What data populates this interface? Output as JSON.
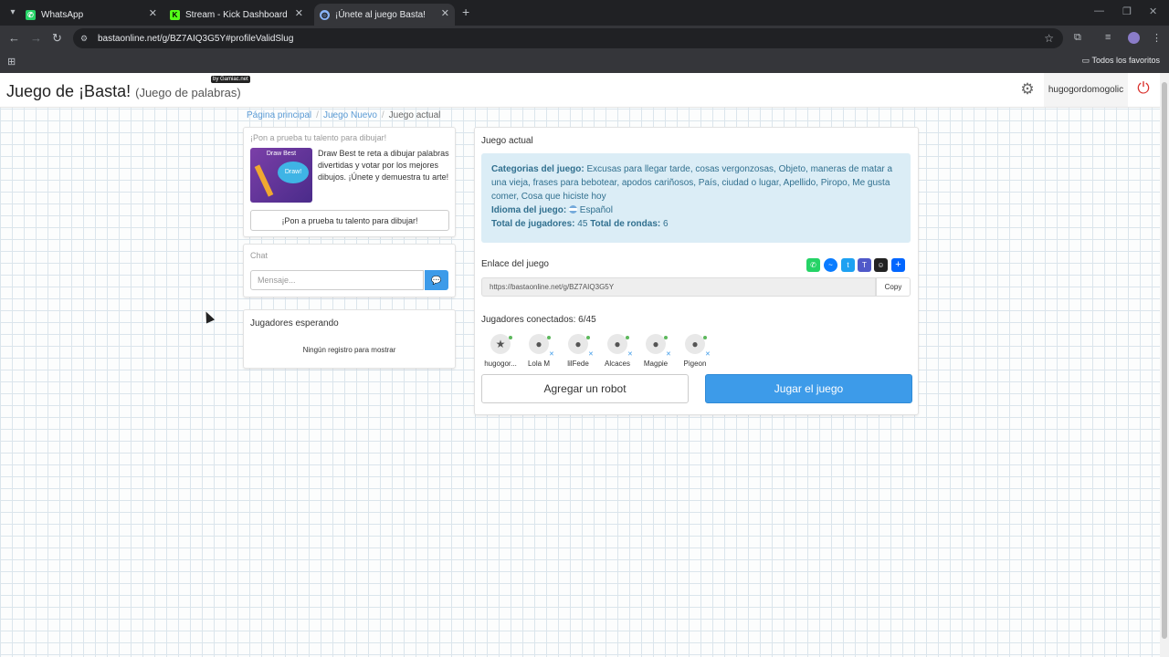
{
  "browser": {
    "tabs": [
      {
        "title": "WhatsApp",
        "icon": "whatsapp-icon"
      },
      {
        "title": "Stream - Kick Dashboard",
        "icon": "kick-icon"
      },
      {
        "title": "¡Únete al juego Basta!",
        "icon": "globe-icon"
      }
    ],
    "url": "bastaonline.net/g/BZ7AIQ3G5Y#profileValidSlug",
    "bookmarks_folder": "Todos los favoritos"
  },
  "header": {
    "title": "Juego de ¡Basta!",
    "subtitle": "(Juego de palabras)",
    "badge": "by Gamiac.net",
    "username": "hugogordomogolic"
  },
  "breadcrumb": {
    "home": "Página principal",
    "new_game": "Juego Nuevo",
    "current": "Juego actual"
  },
  "promo": {
    "title": "¡Pon a prueba tu talento para dibujar!",
    "image_title": "Draw Best",
    "image_bubble": "Draw!",
    "description": "Draw Best te reta a dibujar palabras divertidas y votar por los mejores dibujos. ¡Únete y demuestra tu arte!",
    "button_label": "¡Pon a prueba tu talento para dibujar!"
  },
  "chat": {
    "title": "Chat",
    "placeholder": "Mensaje..."
  },
  "waiting": {
    "title": "Jugadores esperando",
    "empty": "Ningún registro para mostrar"
  },
  "game": {
    "title": "Juego actual",
    "categories_label": "Categorias del juego:",
    "categories": "Excusas para llegar tarde, cosas vergonzosas, Objeto, maneras de matar a una vieja, frases para bebotear, apodos cariñosos, País, ciudad o lugar, Apellido, Piropo, Me gusta comer, Cosa que hiciste hoy",
    "language_label": "Idioma del juego:",
    "language": "Español",
    "players_total_label": "Total de jugadores:",
    "players_total": "45",
    "rounds_label": "Total de rondas:",
    "rounds": "6",
    "link_label": "Enlace del juego",
    "link": "https://bastaonline.net/g/BZ7AIQ3G5Y",
    "copy_label": "Copy",
    "connected_label": "Jugadores conectados: 6/45",
    "players": [
      {
        "name": "hugogor...",
        "icon": "host-user-icon"
      },
      {
        "name": "Lola M",
        "icon": "user-icon"
      },
      {
        "name": "lilFede",
        "icon": "user-icon"
      },
      {
        "name": "Alcaces",
        "icon": "user-icon"
      },
      {
        "name": "Magpie",
        "icon": "user-icon"
      },
      {
        "name": "Pigeon",
        "icon": "user-icon"
      }
    ],
    "add_robot_label": "Agregar un robot",
    "play_label": "Jugar el juego"
  },
  "colors": {
    "primary": "#3d9be9",
    "info_bg": "#dbedf6",
    "info_text": "#31708f",
    "power": "#d9302c"
  }
}
